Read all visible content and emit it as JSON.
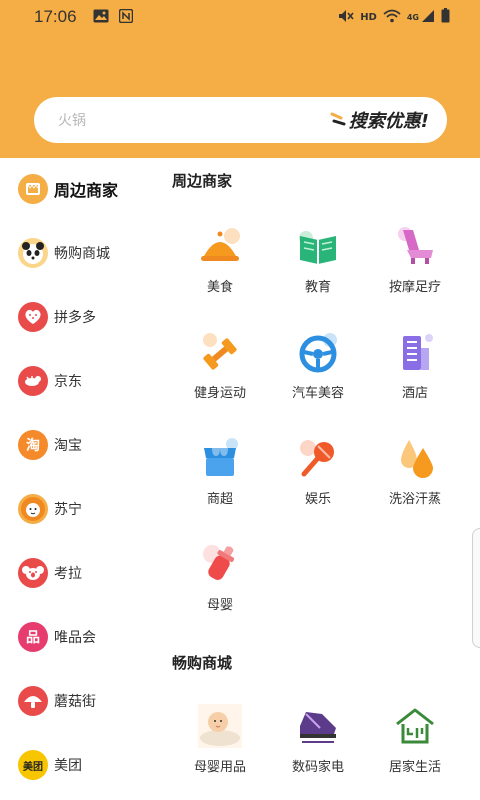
{
  "status_bar": {
    "time": "17:06",
    "network": "HD",
    "signal_type": "4G",
    "icons": [
      "image-icon",
      "nfc-icon",
      "mute-icon",
      "wifi-icon",
      "signal-icon",
      "battery-icon"
    ]
  },
  "search": {
    "placeholder": "火锅",
    "promo_text": "搜索优惠!"
  },
  "sidebar": {
    "items": [
      {
        "label": "周边商家",
        "icon": "shop-icon",
        "color": "#f5ad45",
        "active": true
      },
      {
        "label": "畅购商城",
        "icon": "panda-icon",
        "color": "#f5ad45"
      },
      {
        "label": "拼多多",
        "icon": "pinduoduo-icon",
        "color": "#e94a4a"
      },
      {
        "label": "京东",
        "icon": "jd-icon",
        "color": "#e94a4a"
      },
      {
        "label": "淘宝",
        "icon": "taobao-icon",
        "color": "#f58a2a"
      },
      {
        "label": "苏宁",
        "icon": "suning-lion-icon",
        "color": "#f5ad45"
      },
      {
        "label": "考拉",
        "icon": "koala-icon",
        "color": "#e94a4a"
      },
      {
        "label": "唯品会",
        "icon": "vip-icon",
        "color": "#e63d6e"
      },
      {
        "label": "蘑菇街",
        "icon": "mogujie-icon",
        "color": "#e94a4a"
      },
      {
        "label": "美团",
        "icon": "meituan-icon",
        "color": "#f7c600",
        "badge": "美团"
      }
    ]
  },
  "sections": [
    {
      "title": "周边商家",
      "categories": [
        {
          "label": "美食",
          "icon": "food-bell-icon"
        },
        {
          "label": "教育",
          "icon": "book-icon"
        },
        {
          "label": "按摩足疗",
          "icon": "massage-chair-icon"
        },
        {
          "label": "健身运动",
          "icon": "dumbbell-icon"
        },
        {
          "label": "汽车美容",
          "icon": "steering-wheel-icon"
        },
        {
          "label": "酒店",
          "icon": "hotel-icon"
        },
        {
          "label": "商超",
          "icon": "supermarket-icon"
        },
        {
          "label": "娱乐",
          "icon": "microphone-icon"
        },
        {
          "label": "洗浴汗蒸",
          "icon": "drops-icon"
        },
        {
          "label": "母婴",
          "icon": "baby-bottle-icon"
        }
      ]
    },
    {
      "title": "畅购商城",
      "categories": [
        {
          "label": "母婴用品",
          "icon": "baby-photo-icon"
        },
        {
          "label": "数码家电",
          "icon": "shoes-photo-icon"
        },
        {
          "label": "居家生活",
          "icon": "home-logo-icon"
        }
      ]
    }
  ],
  "colors": {
    "header_bg": "#f5ad45",
    "accent": "#f5ad45"
  }
}
